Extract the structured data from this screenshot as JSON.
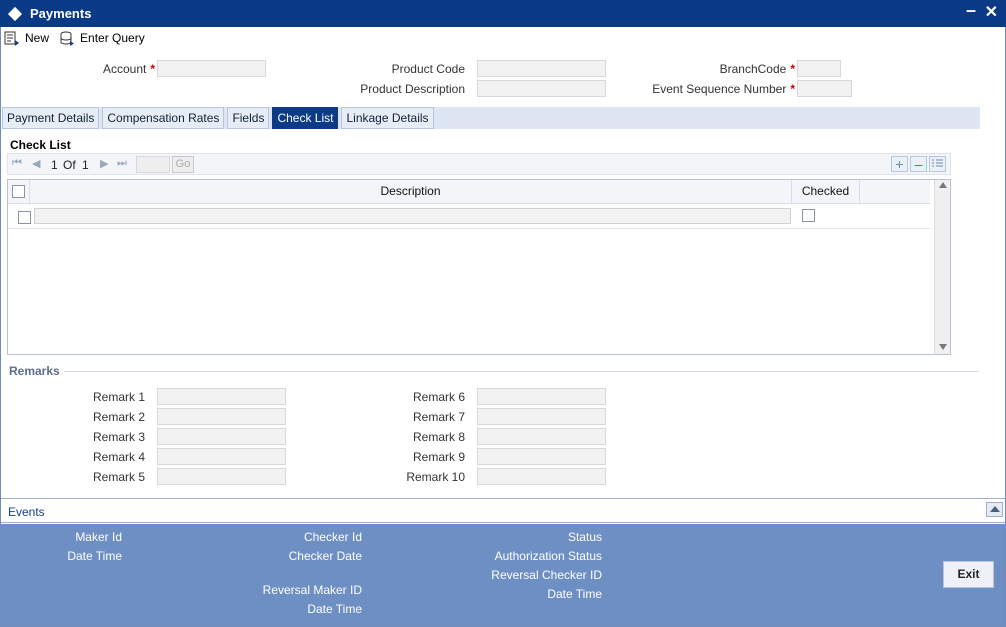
{
  "window": {
    "title": "Payments"
  },
  "toolbar": {
    "new_label": "New",
    "enter_query_label": "Enter Query"
  },
  "header_fields": {
    "account_label": "Account",
    "product_code_label": "Product Code",
    "product_description_label": "Product Description",
    "branch_code_label": "BranchCode",
    "event_sequence_label": "Event Sequence Number",
    "required_mark": "*"
  },
  "tabs": [
    {
      "label": "Payment Details"
    },
    {
      "label": "Compensation Rates"
    },
    {
      "label": "Fields"
    },
    {
      "label": "Check List"
    },
    {
      "label": "Linkage Details"
    }
  ],
  "checklist": {
    "title": "Check List",
    "page_current": "1",
    "page_of": "Of",
    "page_total": "1",
    "go_label": "Go",
    "columns": {
      "description": "Description",
      "checked": "Checked"
    }
  },
  "remarks": {
    "title": "Remarks",
    "labels": [
      "Remark 1",
      "Remark 2",
      "Remark 3",
      "Remark 4",
      "Remark 5",
      "Remark 6",
      "Remark 7",
      "Remark 8",
      "Remark 9",
      "Remark 10"
    ]
  },
  "events": {
    "label": "Events"
  },
  "footer": {
    "maker_id": "Maker Id",
    "date_time_1": "Date Time",
    "checker_id": "Checker Id",
    "checker_date": "Checker Date",
    "reversal_maker_id": "Reversal Maker ID",
    "date_time_2": "Date Time",
    "status": "Status",
    "authorization_status": "Authorization Status",
    "reversal_checker_id": "Reversal Checker ID",
    "date_time_3": "Date Time",
    "exit_label": "Exit"
  },
  "icons": {
    "window": "diamond-icon",
    "minimize": "minimize-icon",
    "close": "close-icon",
    "new": "new-document-icon",
    "enter_query": "enter-query-icon"
  }
}
